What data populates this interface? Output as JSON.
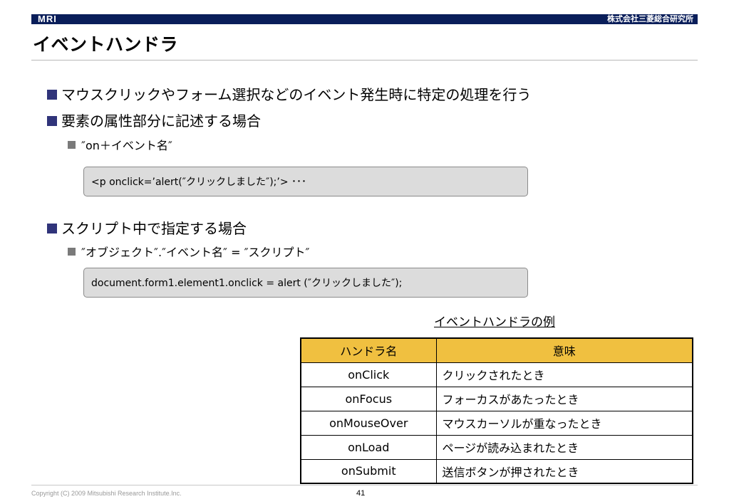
{
  "header": {
    "logo_text": "MRI",
    "company": "株式会社三菱総合研究所",
    "bar_color": "#0a1e5a"
  },
  "title": "イベントハンドラ",
  "bullets": {
    "b1": "マウスクリックやフォーム選択などのイベント発生時に特定の処理を行う",
    "b2": "要素の属性部分に記述する場合",
    "b2_sub": "″on＋イベント名″",
    "code1": "<p onclick=’alert(″クリックしました″);’> ･･･",
    "b3": "スクリプト中で指定する場合",
    "b3_sub": "″オブジェクト″.″イベント名″ = ″スクリプト″",
    "code2": "document.form1.element1.onclick = alert (″クリックしました″);"
  },
  "table": {
    "caption": "イベントハンドラの例",
    "header_color": "#f0c040",
    "columns": [
      "ハンドラ名",
      "意味"
    ],
    "rows": [
      [
        "onClick",
        "クリックされたとき"
      ],
      [
        "onFocus",
        "フォーカスがあたったとき"
      ],
      [
        "onMouseOver",
        "マウスカーソルが重なったとき"
      ],
      [
        "onLoad",
        "ページが読み込まれたとき"
      ],
      [
        "onSubmit",
        "送信ボタンが押されたとき"
      ]
    ]
  },
  "footer": {
    "copyright": "Copyright (C) 2009 Mitsubishi Research Institute.Inc.",
    "page_number": "41"
  }
}
